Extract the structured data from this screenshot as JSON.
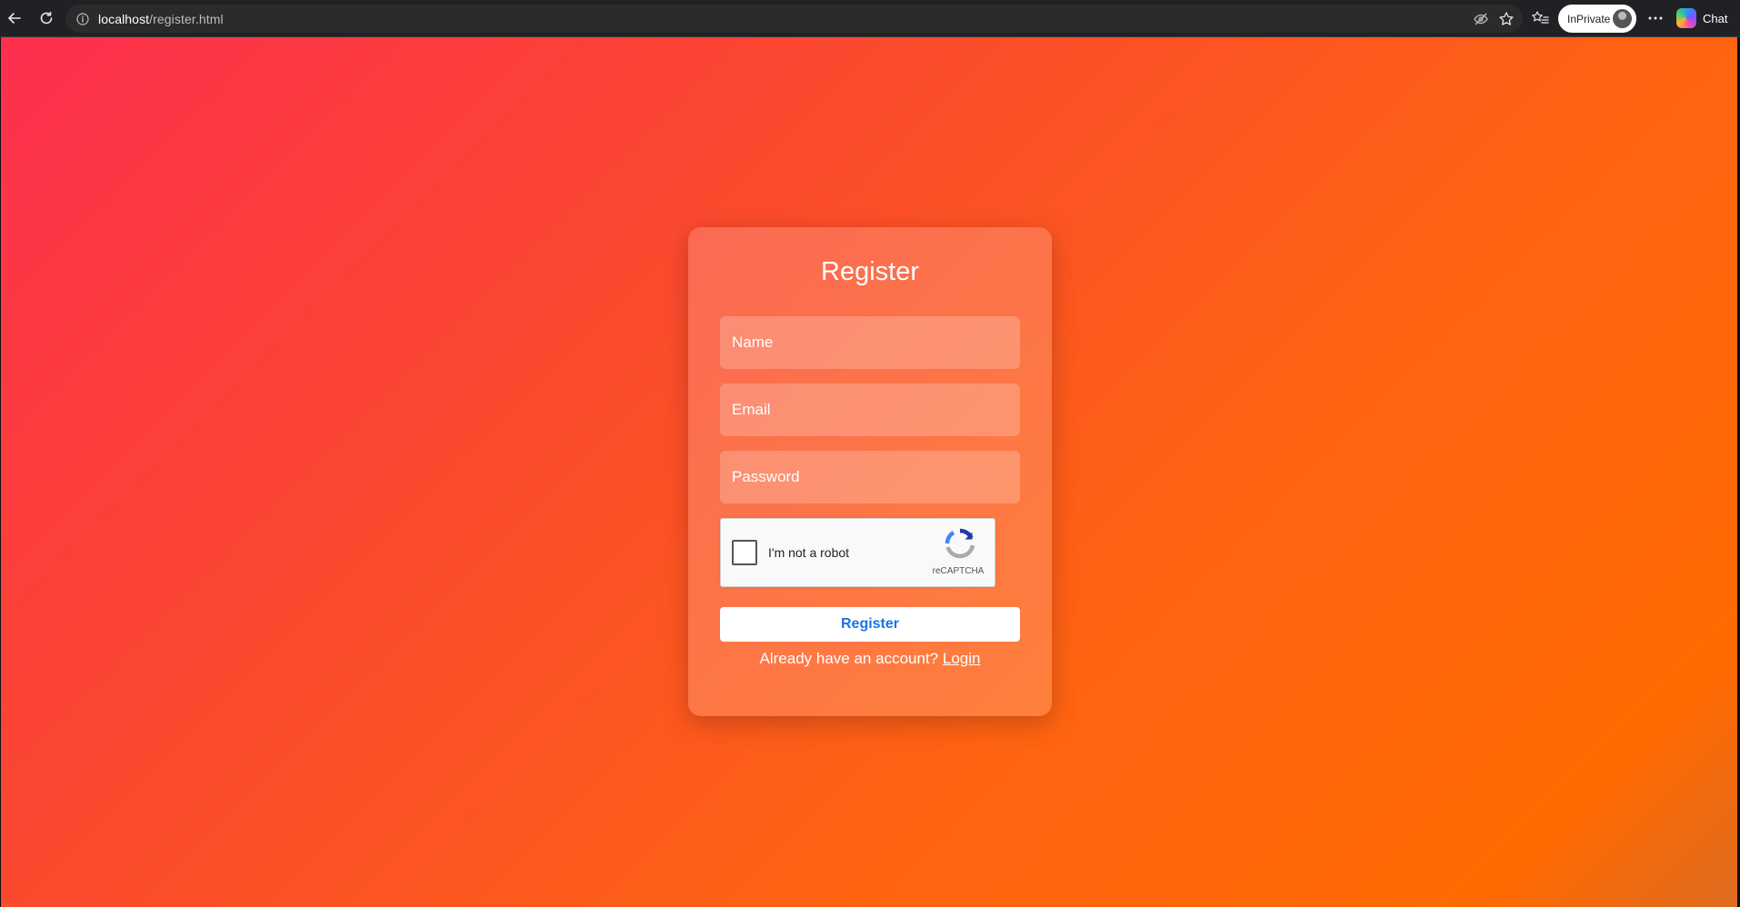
{
  "browser": {
    "url_host": "localhost",
    "url_path": "/register.html",
    "inprivate_label": "InPrivate",
    "chat_label": "Chat"
  },
  "form": {
    "title": "Register",
    "name_placeholder": "Name",
    "email_placeholder": "Email",
    "password_placeholder": "Password",
    "captcha_label": "I'm not a robot",
    "captcha_brand": "reCAPTCHA",
    "submit_label": "Register",
    "login_prompt": "Already have an account?",
    "login_link": "Login"
  },
  "colors": {
    "gradient_start": "#fc2f4e",
    "gradient_end": "#ff6a00",
    "button_text": "#1a73e8"
  }
}
